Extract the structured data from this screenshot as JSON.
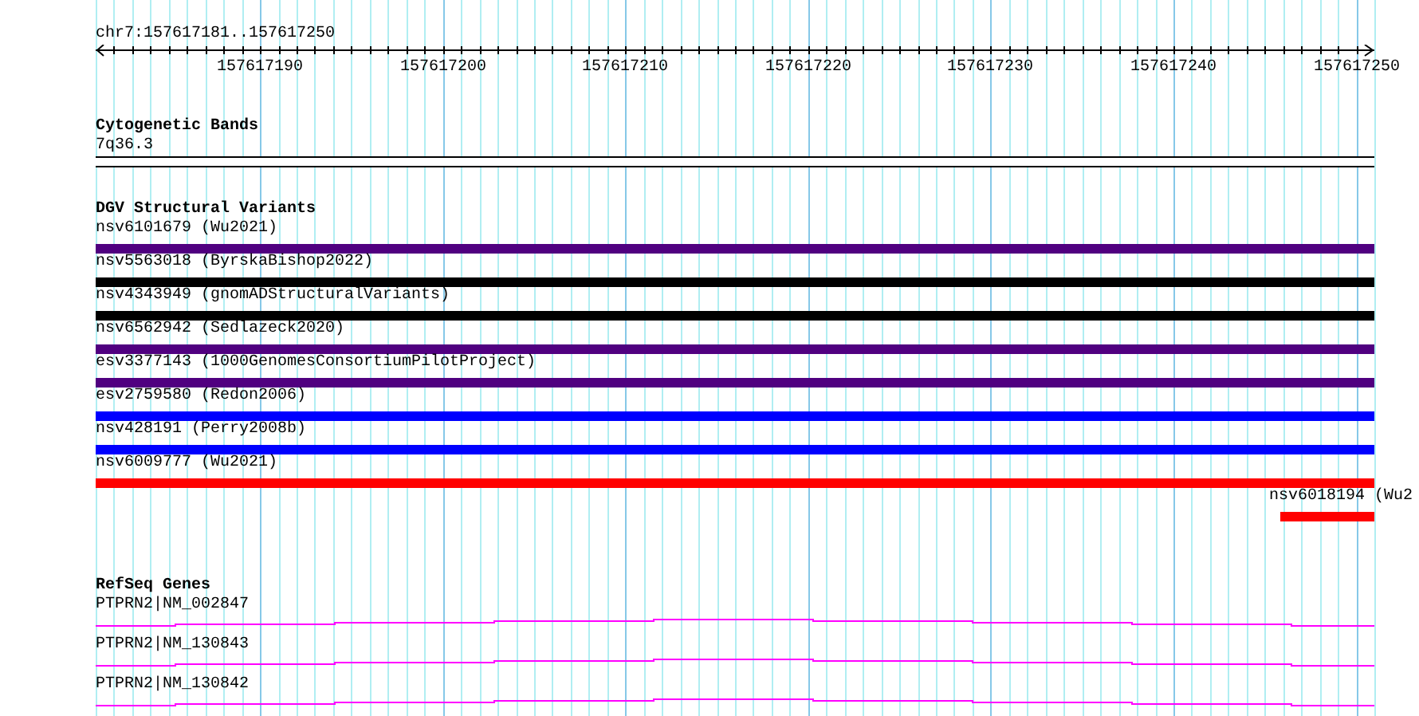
{
  "ruler": {
    "location": "chr7:157617181..157617250",
    "labels": [
      "157617190",
      "157617200",
      "157617210",
      "157617220",
      "157617230",
      "157617240",
      "157617250"
    ]
  },
  "tracks": [
    {
      "kind": "cytobands",
      "title": "Cytogenetic Bands",
      "features": [
        {
          "label": "7q36.3"
        }
      ]
    },
    {
      "kind": "variants",
      "title": "DGV Structural Variants",
      "features": [
        {
          "label": "nsv6101679 (Wu2021)",
          "color": "#500080",
          "kind": "full"
        },
        {
          "label": "nsv5563018 (ByrskaBishop2022)",
          "color": "#000000",
          "kind": "full"
        },
        {
          "label": "nsv4343949 (gnomADStructuralVariants)",
          "color": "#000000",
          "kind": "full"
        },
        {
          "label": "nsv6562942 (Sedlazeck2020)",
          "color": "#500080",
          "kind": "full"
        },
        {
          "label": "esv3377143 (1000GenomesConsortiumPilotProject)",
          "color": "#500080",
          "kind": "full"
        },
        {
          "label": "esv2759580 (Redon2006)",
          "color": "#0000ff",
          "kind": "full"
        },
        {
          "label": "nsv428191 (Perry2008b)",
          "color": "#0000ff",
          "kind": "full"
        },
        {
          "label": "nsv6009777 (Wu2021)",
          "color": "#ff0000",
          "kind": "full"
        },
        {
          "label": "nsv6018194 (Wu2",
          "color": "#ff0000",
          "kind": "tail"
        }
      ]
    },
    {
      "kind": "genes",
      "title": "RefSeq Genes",
      "features": [
        {
          "label": "PTPRN2|NM_002847"
        },
        {
          "label": "PTPRN2|NM_130843"
        },
        {
          "label": "PTPRN2|NM_130842"
        }
      ]
    }
  ]
}
